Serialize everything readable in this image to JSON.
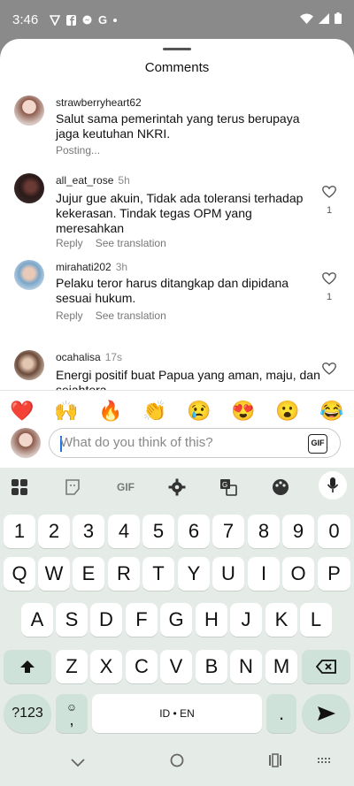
{
  "status_bar": {
    "time": "3:46"
  },
  "sheet": {
    "title": "Comments"
  },
  "comments": [
    {
      "user": "strawberryheart62",
      "ago": "",
      "text": "Salut sama pemerintah yang terus berupaya jaga keutuhan NKRI.",
      "status": "Posting...",
      "likes": ""
    },
    {
      "user": "all_eat_rose",
      "ago": "5h",
      "text": "Jujur gue akuin, Tidak ada toleransi terhadap kekerasan. Tindak tegas OPM yang meresahkan",
      "likes": "1"
    },
    {
      "user": "mirahati202",
      "ago": "3h",
      "text": "Pelaku teror harus ditangkap dan dipidana sesuai hukum.",
      "likes": "1"
    },
    {
      "user": "ocahalisa",
      "ago": "17s",
      "text": "Energi positif buat Papua yang aman, maju, dan sejahtera",
      "likes": ""
    }
  ],
  "actions": {
    "reply": "Reply",
    "see_translation": "See translation"
  },
  "emoji_bar": [
    "❤️",
    "🙌",
    "🔥",
    "👏",
    "😢",
    "😍",
    "😮",
    "😂"
  ],
  "compose": {
    "placeholder": "What do you think of this?",
    "gif_label": "GIF"
  },
  "keyboard": {
    "toolbar_gif": "GIF",
    "number_row": [
      "1",
      "2",
      "3",
      "4",
      "5",
      "6",
      "7",
      "8",
      "9",
      "0"
    ],
    "row1": [
      "Q",
      "W",
      "E",
      "R",
      "T",
      "Y",
      "U",
      "I",
      "O",
      "P"
    ],
    "row2": [
      "A",
      "S",
      "D",
      "F",
      "G",
      "H",
      "J",
      "K",
      "L"
    ],
    "row3": [
      "Z",
      "X",
      "C",
      "V",
      "B",
      "N",
      "M"
    ],
    "symbols_key": "?123",
    "comma_key": ",",
    "space_label": "ID • EN",
    "period_key": "."
  }
}
